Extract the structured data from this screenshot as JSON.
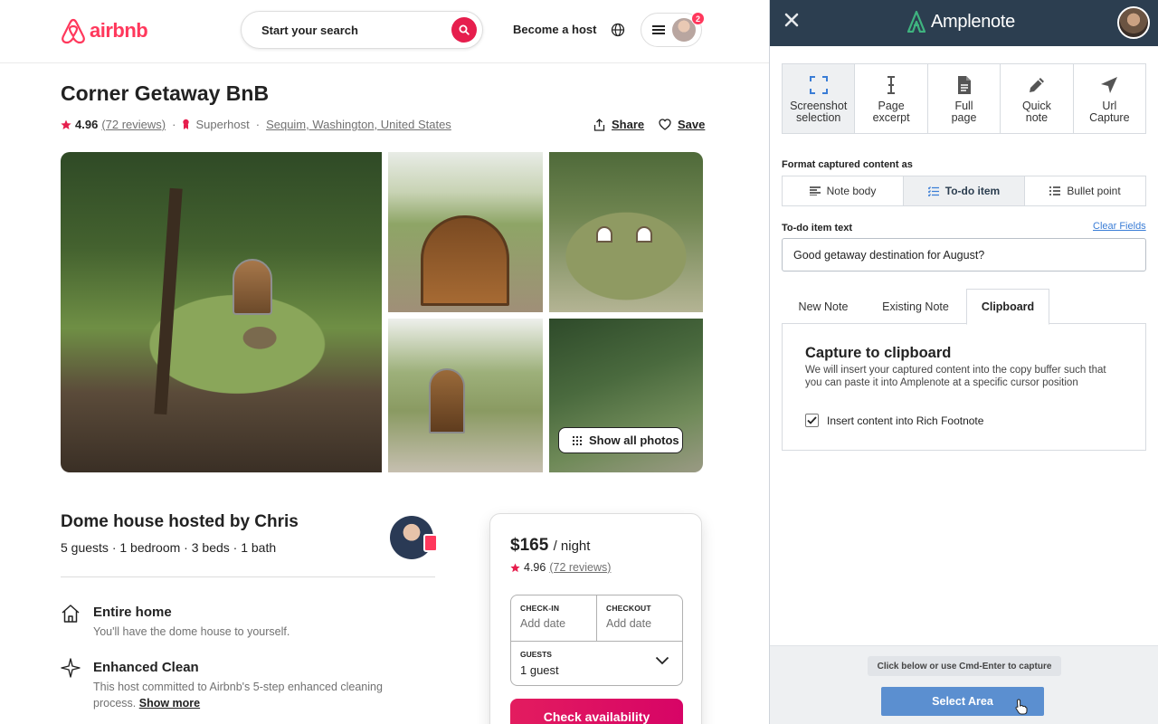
{
  "airbnb": {
    "brand": "airbnb",
    "search_placeholder": "Start your search",
    "become_host": "Become a host",
    "notification_count": "2",
    "listing": {
      "title": "Corner Getaway BnB",
      "rating": "4.96",
      "reviews": "(72 reviews)",
      "superhost": "Superhost",
      "location": "Sequim, Washington, United States",
      "share": "Share",
      "save": "Save",
      "show_all_photos": "Show all photos"
    },
    "host": {
      "title": "Dome house hosted by Chris",
      "summary": "5 guests · 1 bedroom · 3 beds · 1 bath"
    },
    "features": [
      {
        "title": "Entire home",
        "description": "You'll have the dome house to yourself."
      },
      {
        "title": "Enhanced Clean",
        "description": "This host committed to Airbnb's 5-step enhanced cleaning process.",
        "link": "Show more"
      }
    ],
    "booking": {
      "price": "$165",
      "per_night": "/ night",
      "rating": "4.96",
      "reviews": "(72 reviews)",
      "checkin_label": "CHECK-IN",
      "checkin_value": "Add date",
      "checkout_label": "CHECKOUT",
      "checkout_value": "Add date",
      "guests_label": "GUESTS",
      "guests_value": "1 guest",
      "button": "Check availability"
    },
    "colors": {
      "brand": "#ff385c",
      "cta": "#e31c5f"
    }
  },
  "amplenote": {
    "brand": "Amplenote",
    "capture_modes": [
      {
        "line1": "Screenshot",
        "line2": "selection",
        "icon": "screenshot-selection-icon",
        "active": true
      },
      {
        "line1": "Page",
        "line2": "excerpt",
        "icon": "text-cursor-icon",
        "active": false
      },
      {
        "line1": "Full",
        "line2": "page",
        "icon": "document-icon",
        "active": false
      },
      {
        "line1": "Quick",
        "line2": "note",
        "icon": "pencil-icon",
        "active": false
      },
      {
        "line1": "Url",
        "line2": "Capture",
        "icon": "send-icon",
        "active": false
      }
    ],
    "format_label": "Format captured content as",
    "formats": [
      {
        "label": "Note body",
        "active": false
      },
      {
        "label": "To-do item",
        "active": true
      },
      {
        "label": "Bullet point",
        "active": false
      }
    ],
    "todo_label": "To-do item text",
    "clear_fields": "Clear Fields",
    "todo_value": "Good getaway destination for August?",
    "destinations": [
      {
        "label": "New Note",
        "active": false
      },
      {
        "label": "Existing Note",
        "active": false
      },
      {
        "label": "Clipboard",
        "active": true
      }
    ],
    "clipboard": {
      "title": "Capture to clipboard",
      "description": "We will insert your captured content into the copy buffer such that you can paste it into Amplenote at a specific cursor position",
      "checkbox_label": "Insert content into Rich Footnote",
      "checked": true
    },
    "footer_hint": "Click below or use Cmd-Enter to capture",
    "select_area": "Select Area",
    "colors": {
      "header": "#2c3e50",
      "accent": "#5b8fd0",
      "logo": "#3fb37f"
    }
  }
}
